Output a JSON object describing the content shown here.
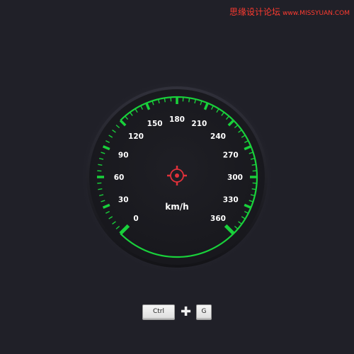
{
  "watermark": {
    "site_name": "思缘设计论坛",
    "url": "www.MISSYUAN.COM"
  },
  "speedometer": {
    "unit": "km/h",
    "labels": [
      "0",
      "30",
      "60",
      "90",
      "120",
      "150",
      "180",
      "210",
      "240",
      "270",
      "300",
      "330",
      "360"
    ],
    "min": 0,
    "max": 360,
    "sweep_degrees": 270,
    "accent_color": "#19d13b",
    "center_color": "#e0313a",
    "label_color": "#ffffff"
  },
  "shortcut": {
    "key1": "Ctrl",
    "separator_icon": "plus-icon",
    "key2": "G"
  }
}
